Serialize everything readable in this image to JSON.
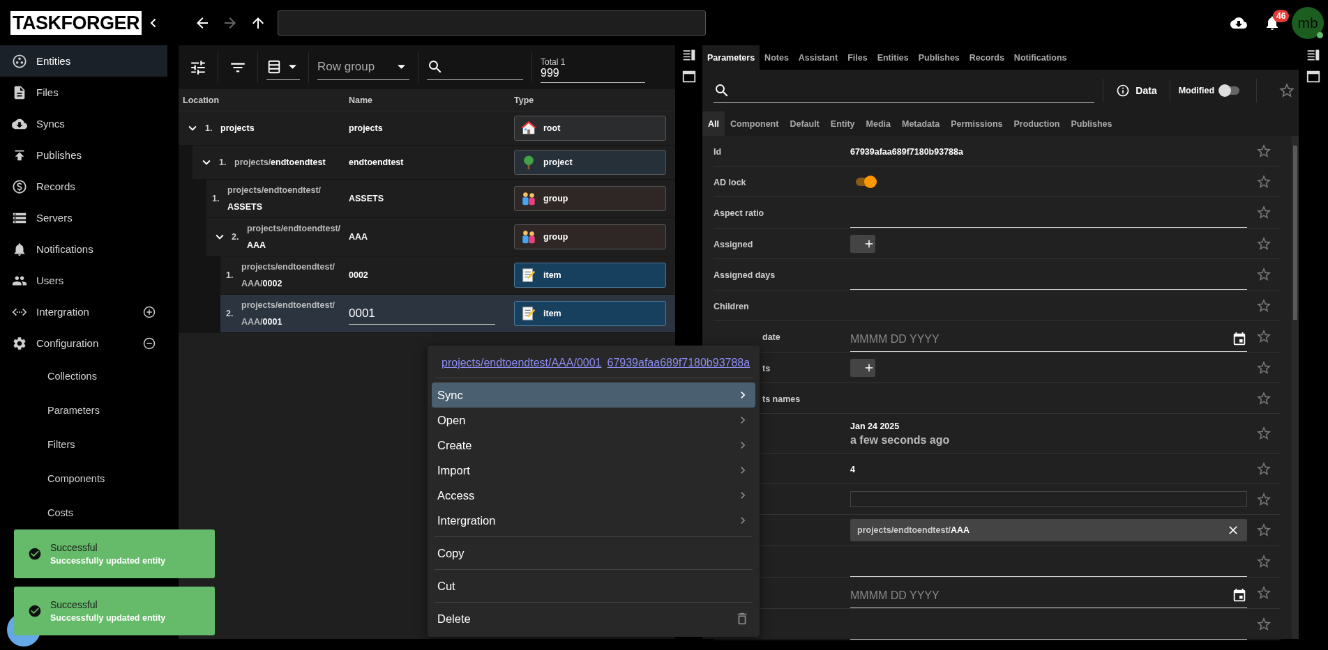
{
  "app": {
    "logo": "TASKFORGER"
  },
  "nav_buttons": [
    {
      "kind": "back",
      "disabled": false
    },
    {
      "kind": "forward",
      "disabled": true
    },
    {
      "kind": "up",
      "disabled": false
    }
  ],
  "header": {
    "notifications_count": "46",
    "avatar": "mb",
    "online": true
  },
  "sidebar": {
    "items": [
      {
        "label": "Entities",
        "selected": true
      },
      {
        "label": "Files",
        "selected": false
      },
      {
        "label": "Syncs",
        "selected": false
      },
      {
        "label": "Publishes",
        "selected": false
      },
      {
        "label": "Records",
        "selected": false
      },
      {
        "label": "Servers",
        "selected": false
      },
      {
        "label": "Notifications",
        "selected": false
      },
      {
        "label": "Users",
        "selected": false
      },
      {
        "label": "Intergration",
        "selected": false,
        "expanded": false
      },
      {
        "label": "Configuration",
        "selected": false,
        "expanded": true,
        "children": [
          {
            "label": "Collections",
            "selected": false
          },
          {
            "label": "Parameters",
            "selected": false
          },
          {
            "label": "Filters",
            "selected": false
          },
          {
            "label": "Components",
            "selected": false
          },
          {
            "label": "Costs",
            "selected": false
          }
        ]
      }
    ]
  },
  "table": {
    "toolbar": {
      "row_group_placeholder": "Row group",
      "total_label": "Total 1",
      "total_value": "999"
    },
    "columns": [
      "Location",
      "Name",
      "Type"
    ],
    "rows": [
      {
        "index": "1.",
        "location": "projects",
        "name": "projects",
        "type": {
          "kind": "root",
          "label": "root"
        },
        "expanded": true,
        "selected": false,
        "editing": false,
        "children": [
          {
            "index": "1.",
            "location": "projects/**endtoendtest**",
            "name": "endtoendtest",
            "type": {
              "kind": "project",
              "label": "project"
            },
            "expanded": true,
            "selected": false,
            "editing": false,
            "children": [
              {
                "index": "1.",
                "location": "projects/endtoendtest/**ASSETS**",
                "name": "ASSETS",
                "type": {
                  "kind": "group",
                  "label": "group"
                },
                "selected": false,
                "editing": false
              },
              {
                "index": "2.",
                "location": "projects/endtoendtest/**AAA**",
                "name": "AAA",
                "type": {
                  "kind": "group",
                  "label": "group"
                },
                "expanded": true,
                "selected": false,
                "editing": false,
                "children": [
                  {
                    "index": "1.",
                    "location": "projects/endtoendtest/AAA/**0002**",
                    "name": "0002",
                    "type": {
                      "kind": "item",
                      "label": "item"
                    },
                    "selected": false,
                    "editing": false
                  },
                  {
                    "index": "2.",
                    "location": "projects/endtoendtest/AAA/**0001**",
                    "name": "0001",
                    "type": {
                      "kind": "item",
                      "label": "item"
                    },
                    "selected": true,
                    "editing": true
                  }
                ]
              }
            ]
          }
        ]
      }
    ]
  },
  "context_menu": {
    "links": [
      "projects/endtoendtest/AAA/0001",
      "67939afaa689f7180b93788a"
    ],
    "groups": [
      [
        {
          "label": "Sync",
          "kind": "submenu",
          "selected": true
        },
        {
          "label": "Open",
          "kind": "submenu",
          "selected": false
        },
        {
          "label": "Create",
          "kind": "submenu",
          "selected": false
        },
        {
          "label": "Import",
          "kind": "submenu",
          "selected": false
        },
        {
          "label": "Access",
          "kind": "submenu",
          "selected": false
        },
        {
          "label": "Intergration",
          "kind": "submenu",
          "selected": false
        }
      ],
      [
        {
          "label": "Copy",
          "kind": "plain",
          "selected": false
        }
      ],
      [
        {
          "label": "Cut",
          "kind": "plain",
          "selected": false
        }
      ],
      [
        {
          "label": "Delete",
          "kind": "delete",
          "selected": false
        }
      ]
    ]
  },
  "details": {
    "tabs": [
      {
        "label": "Parameters",
        "selected": true
      },
      {
        "label": "Notes",
        "selected": false
      },
      {
        "label": "Assistant",
        "selected": false
      },
      {
        "label": "Files",
        "selected": false
      },
      {
        "label": "Entities",
        "selected": false
      },
      {
        "label": "Publishes",
        "selected": false
      },
      {
        "label": "Records",
        "selected": false
      },
      {
        "label": "Notifications",
        "selected": false
      }
    ],
    "data_button": "Data",
    "modified_label": "Modified",
    "modified_on": false,
    "categories": [
      {
        "label": "All",
        "selected": true
      },
      {
        "label": "Component",
        "selected": false
      },
      {
        "label": "Default",
        "selected": false
      },
      {
        "label": "Entity",
        "selected": false
      },
      {
        "label": "Media",
        "selected": false
      },
      {
        "label": "Metadata",
        "selected": false
      },
      {
        "label": "Permissions",
        "selected": false
      },
      {
        "label": "Production",
        "selected": false
      },
      {
        "label": "Publishes",
        "selected": false
      }
    ],
    "rows": [
      {
        "kind": "text",
        "label": "Id",
        "value": "67939afaa689f7180b93788a"
      },
      {
        "kind": "toggle",
        "label": "AD lock",
        "on": true
      },
      {
        "kind": "line",
        "label": "Aspect ratio"
      },
      {
        "kind": "add",
        "label": "Assigned"
      },
      {
        "kind": "line",
        "label": "Assigned days"
      },
      {
        "kind": "empty",
        "label": "Children"
      },
      {
        "kind": "date",
        "label": "date",
        "placeholder": "MMMM DD YYYY"
      },
      {
        "kind": "add",
        "label": "ts"
      },
      {
        "kind": "empty",
        "label": "ts names"
      },
      {
        "kind": "datetime",
        "value": "Jan 24 2025",
        "note": "a few seconds ago"
      },
      {
        "kind": "text",
        "value": "4"
      },
      {
        "kind": "box"
      },
      {
        "kind": "chip",
        "value": "projects/endtoendtest/**AAA**"
      },
      {
        "kind": "line"
      },
      {
        "kind": "date",
        "placeholder": "MMMM DD YYYY"
      },
      {
        "kind": "line"
      }
    ]
  },
  "toasts": [
    {
      "title": "Successful",
      "message": "Successfully updated entity"
    },
    {
      "title": "Successful",
      "message": "Successfully updated entity"
    }
  ]
}
